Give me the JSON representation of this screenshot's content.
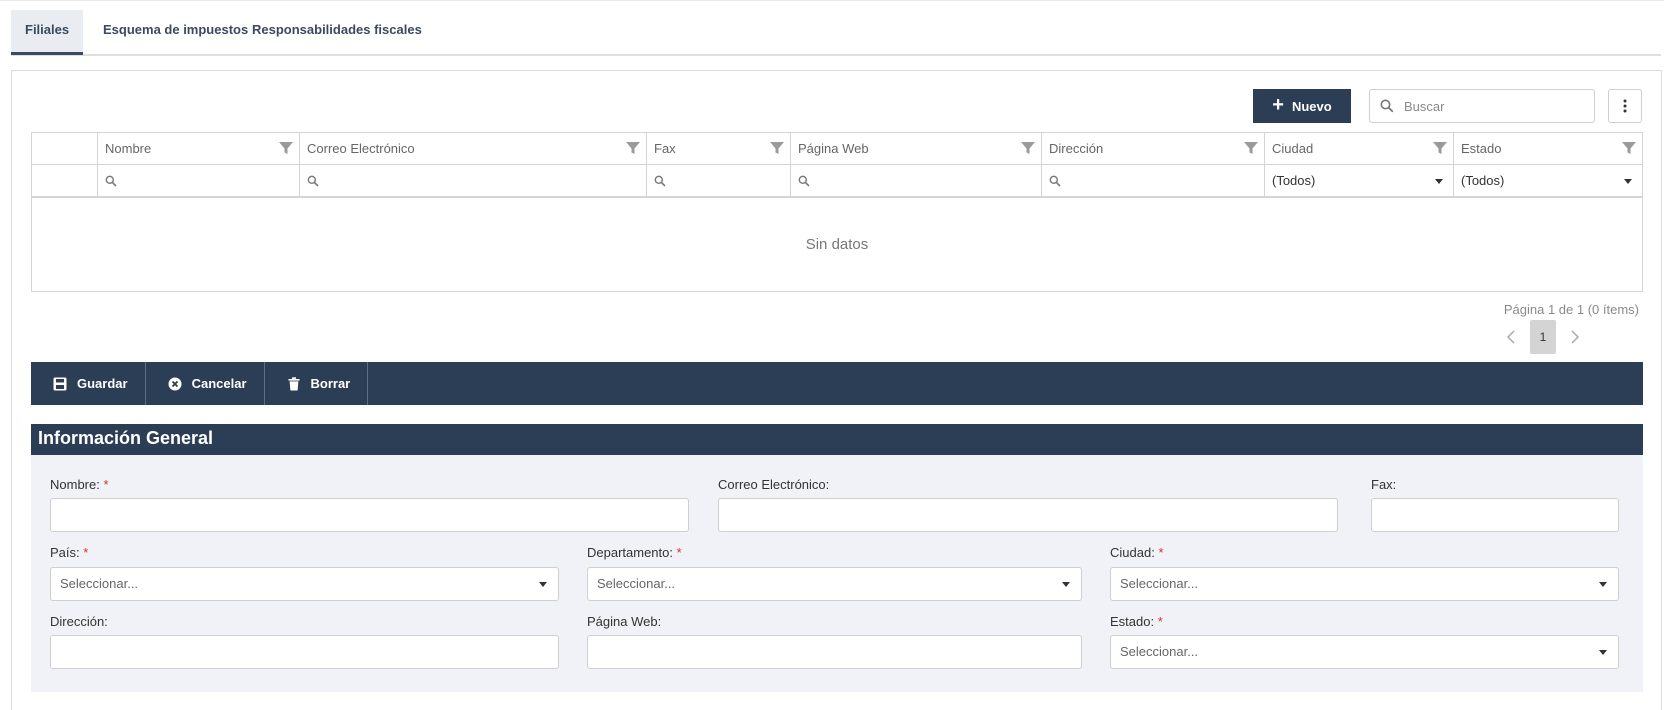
{
  "tabs": [
    {
      "label": "Filiales",
      "active": true
    },
    {
      "label": "Esquema de impuestos",
      "active": false
    },
    {
      "label": "Responsabilidades fiscales",
      "active": false
    }
  ],
  "toolbar_top": {
    "new_label": "Nuevo",
    "search_placeholder": "Buscar"
  },
  "grid": {
    "columns": [
      "Nombre",
      "Correo Electrónico",
      "Fax",
      "Página Web",
      "Dirección",
      "Ciudad",
      "Estado"
    ],
    "filters": {
      "ciudad": "(Todos)",
      "estado": "(Todos)"
    },
    "empty_text": "Sin datos"
  },
  "pager": {
    "info": "Página 1 de 1 (0 ítems)",
    "current_page": "1"
  },
  "actions": {
    "save": "Guardar",
    "cancel": "Cancelar",
    "delete": "Borrar"
  },
  "form": {
    "section_title": "Información General",
    "required_mark": "*",
    "fields": {
      "nombre": "Nombre:",
      "correo": "Correo Electrónico:",
      "fax": "Fax:",
      "pais": "País:",
      "departamento": "Departamento:",
      "ciudad": "Ciudad:",
      "direccion": "Dirección:",
      "pagina_web": "Página Web:",
      "estado": "Estado:"
    },
    "select_placeholder": "Seleccionar..."
  },
  "colors": {
    "primary": "#2b3e56",
    "required": "#d0342c",
    "form_background": "#f1f2f7"
  }
}
